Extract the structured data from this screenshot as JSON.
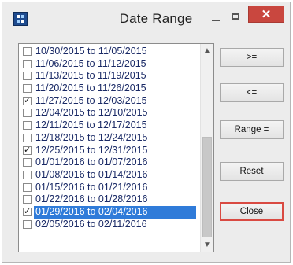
{
  "window": {
    "title": "Date Range",
    "close_glyph": "✕",
    "app_icon": "app-icon"
  },
  "list": {
    "items": [
      {
        "label": "10/30/2015 to 11/05/2015",
        "checked": false,
        "selected": false
      },
      {
        "label": "11/06/2015 to 11/12/2015",
        "checked": false,
        "selected": false
      },
      {
        "label": "11/13/2015 to 11/19/2015",
        "checked": false,
        "selected": false
      },
      {
        "label": "11/20/2015 to 11/26/2015",
        "checked": false,
        "selected": false
      },
      {
        "label": "11/27/2015 to 12/03/2015",
        "checked": true,
        "selected": false
      },
      {
        "label": "12/04/2015 to 12/10/2015",
        "checked": false,
        "selected": false
      },
      {
        "label": "12/11/2015 to 12/17/2015",
        "checked": false,
        "selected": false
      },
      {
        "label": "12/18/2015 to 12/24/2015",
        "checked": false,
        "selected": false
      },
      {
        "label": "12/25/2015 to 12/31/2015",
        "checked": true,
        "selected": false
      },
      {
        "label": "01/01/2016 to 01/07/2016",
        "checked": false,
        "selected": false
      },
      {
        "label": "01/08/2016 to 01/14/2016",
        "checked": false,
        "selected": false
      },
      {
        "label": "01/15/2016 to 01/21/2016",
        "checked": false,
        "selected": false
      },
      {
        "label": "01/22/2016 to 01/28/2016",
        "checked": false,
        "selected": false
      },
      {
        "label": "01/29/2016 to 02/04/2016",
        "checked": true,
        "selected": true
      },
      {
        "label": "02/05/2016 to 02/11/2016",
        "checked": false,
        "selected": false
      }
    ],
    "scroll_up_glyph": "▲",
    "scroll_down_glyph": "▼"
  },
  "buttons": {
    "gte_label": ">=",
    "lte_label": "<=",
    "range_label": "Range =",
    "reset_label": "Reset",
    "close_label": "Close"
  },
  "colors": {
    "selection": "#2f7bd9",
    "close_titlebar": "#c9473f",
    "close_button_border": "#d94a42"
  }
}
